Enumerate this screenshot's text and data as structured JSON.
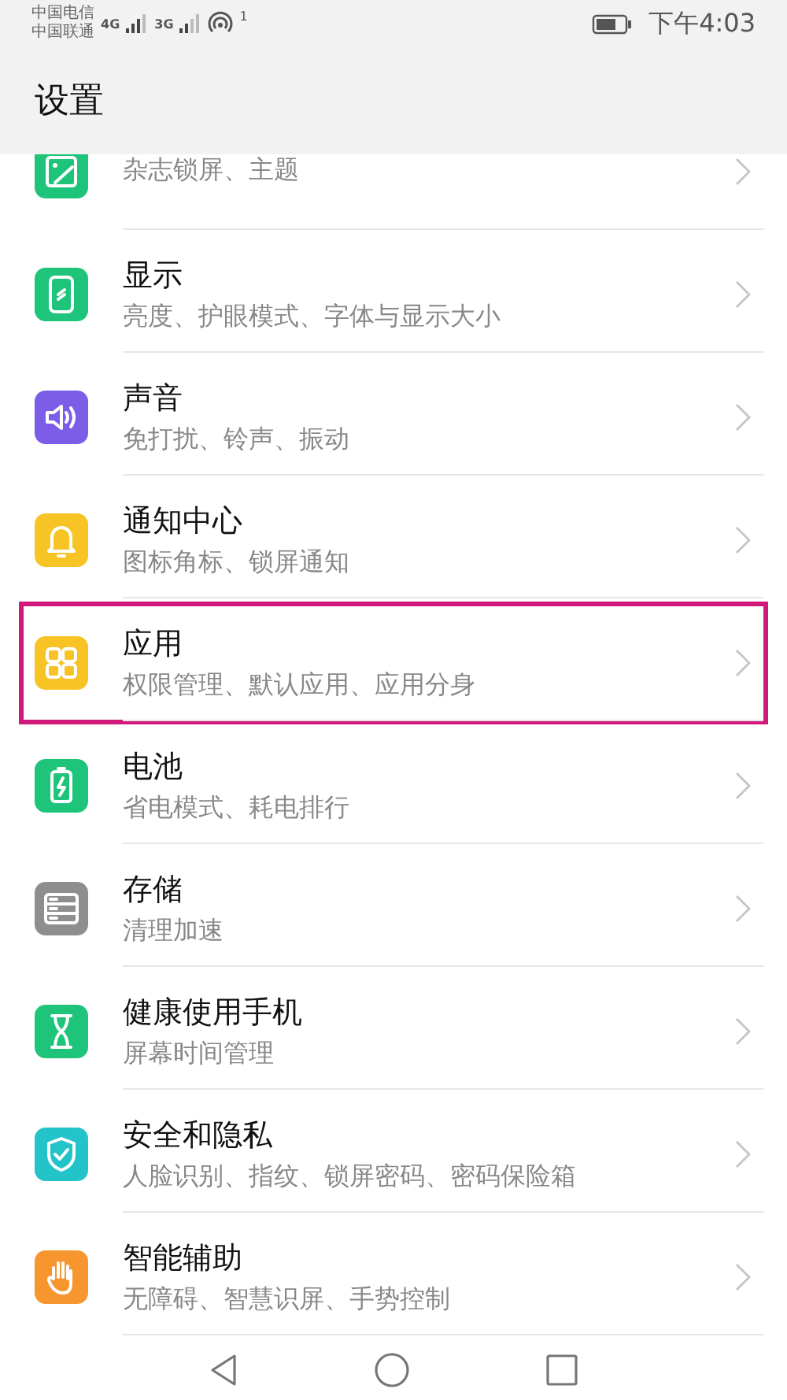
{
  "status_bar": {
    "carriers": [
      "中国电信",
      "中国联通"
    ],
    "network_labels": [
      "4G",
      "3G"
    ],
    "hotspot_count": "1",
    "time": "下午4:03"
  },
  "header": {
    "title": "设置"
  },
  "partial_item": {
    "subtitle": "杂志锁屏、主题",
    "color": "#1dc47a",
    "kind": "wallpaper"
  },
  "items": [
    {
      "title": "显示",
      "subtitle": "亮度、护眼模式、字体与显示大小",
      "color": "#1dc47a",
      "kind": "display",
      "highlighted": false
    },
    {
      "title": "声音",
      "subtitle": "免打扰、铃声、振动",
      "color": "#7b5de8",
      "kind": "sound",
      "highlighted": false
    },
    {
      "title": "通知中心",
      "subtitle": "图标角标、锁屏通知",
      "color": "#f7c325",
      "kind": "bell",
      "highlighted": false
    },
    {
      "title": "应用",
      "subtitle": "权限管理、默认应用、应用分身",
      "color": "#f7c325",
      "kind": "apps",
      "highlighted": true
    },
    {
      "title": "电池",
      "subtitle": "省电模式、耗电排行",
      "color": "#1dc47a",
      "kind": "battery",
      "highlighted": false
    },
    {
      "title": "存储",
      "subtitle": "清理加速",
      "color": "#8e8e8e",
      "kind": "storage",
      "highlighted": false
    },
    {
      "title": "健康使用手机",
      "subtitle": "屏幕时间管理",
      "color": "#1dc47a",
      "kind": "hourglass",
      "highlighted": false
    },
    {
      "title": "安全和隐私",
      "subtitle": "人脸识别、指纹、锁屏密码、密码保险箱",
      "color": "#22c3c9",
      "kind": "shield",
      "highlighted": false
    },
    {
      "title": "智能辅助",
      "subtitle": "无障碍、智慧识屏、手势控制",
      "color": "#f7952f",
      "kind": "hand",
      "highlighted": false
    }
  ]
}
